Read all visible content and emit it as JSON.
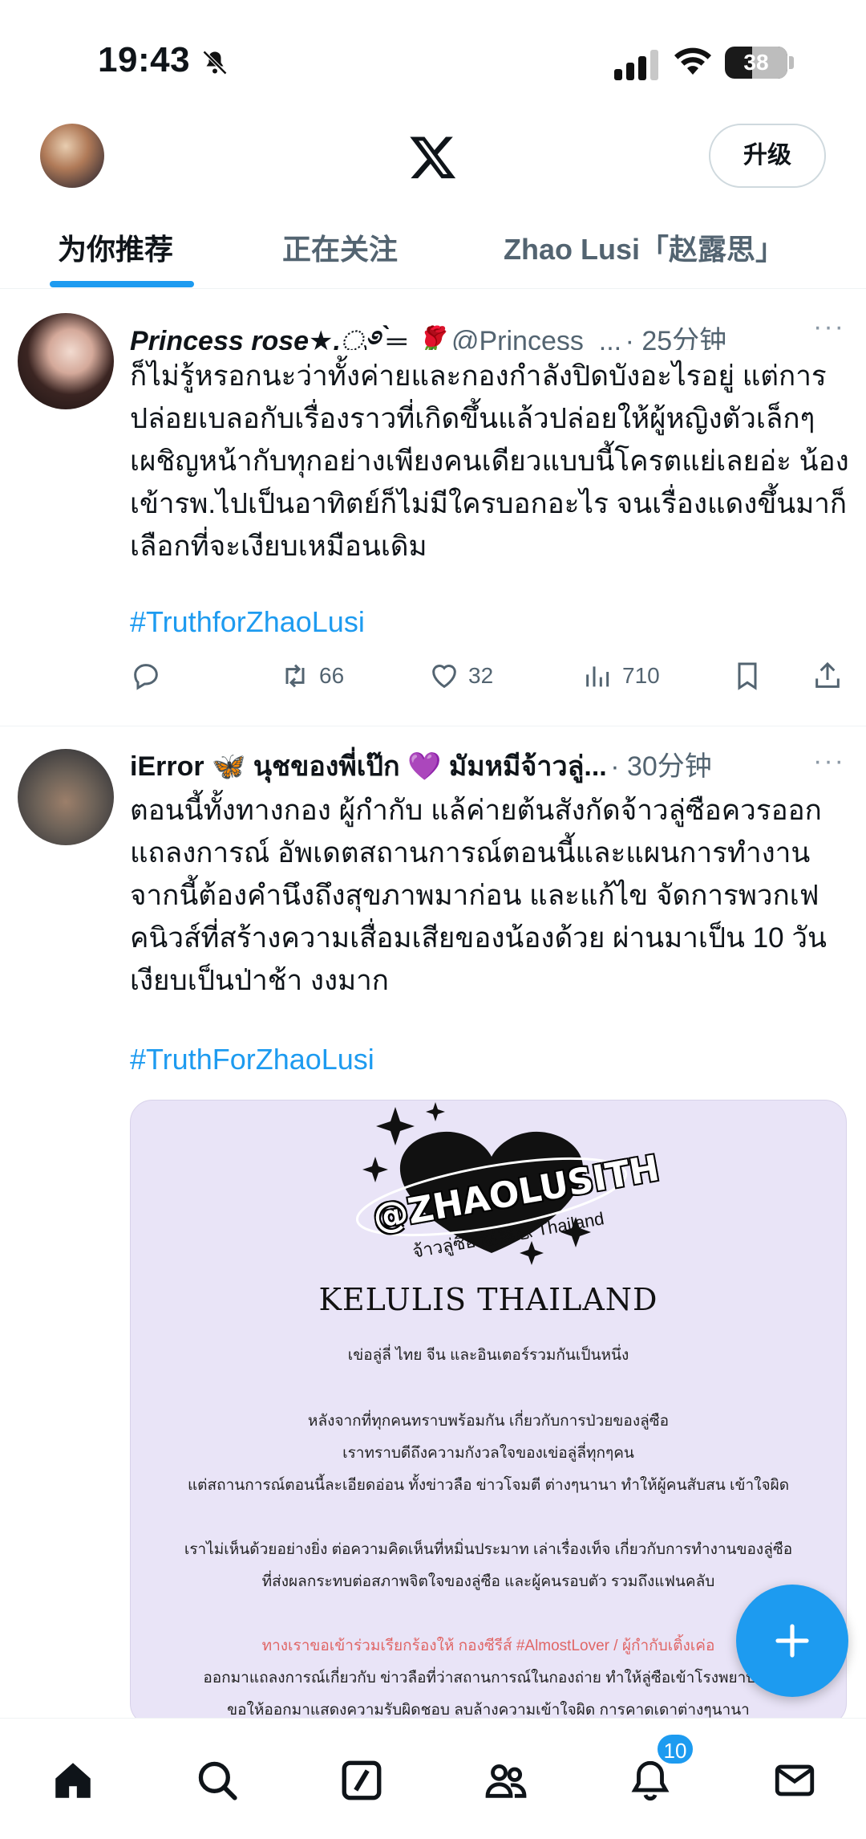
{
  "status_bar": {
    "time": "19:43",
    "battery": "38"
  },
  "header": {
    "upgrade_label": "升级"
  },
  "tabs": [
    {
      "label": "为你推荐"
    },
    {
      "label": "正在关注"
    },
    {
      "label": "Zhao Lusi「赵露思」"
    }
  ],
  "posts": [
    {
      "name": "Princess rose★.ೃ࿔ ̗̀═ 🌹",
      "handle": "@Princess_...",
      "time": "· 25分钟",
      "more": "···",
      "text": "ก็ไม่รู้หรอกนะว่าทั้งค่ายและกองกำลังปิดบังอะไรอยู่ แต่การปล่อยเบลอกับเรื่องราวที่เกิดขึ้นแล้วปล่อยให้ผู้หญิงตัวเล็กๆเผชิญหน้ากับทุกอย่างเพียงคนเดียวแบบนี้โครตแย่เลยอ่ะ น้องเข้ารพ.ไปเป็นอาทิตย์ก็ไม่มีใครบอกอะไร จนเรื่องแดงขึ้นมาก็เลือกที่จะเงียบเหมือนเดิม",
      "hashtag": "#TruthforZhaoLusi",
      "retweets": "66",
      "likes": "32",
      "views": "710"
    },
    {
      "name": "iError 🦋 นุชของพี่เป๊ก 💜 มัมหมีจ้าวลู่...",
      "time": "· 30分钟",
      "more": "···",
      "text": "ตอนนี้ทั้งทางกอง ผู้กำกับ แล้ค่ายต้นสังกัดจ้าวลู่ซือควรออกแถลงการณ์ อัพเดตสถานการณ์ตอนนี้และแผนการทำงานจากนี้ต้องคำนึงถึงสุขภาพมาก่อน และแก้ไข จัดการพวกเฟคนิวส์ที่สร้างความเสื่อมเสียของน้องด้วย ผ่านมาเป็น 10 วัน เงียบเป็นป่าช้า งงมาก",
      "hashtag": "#TruthForZhaoLusi",
      "media": {
        "logo_text": "@ZHAOLUSITH",
        "logo_sub": "จ้าวลู่ซือ 赵露思 Thailand",
        "title": "KELULIS THAILAND",
        "lines": [
          "เข่อลู่ลี่ ไทย จีน และอินเตอร์รวมกันเป็นหนึ่ง",
          "หลังจากที่ทุกคนทราบพร้อมกัน เกี่ยวกับการป่วยของลู่ซือ",
          "เราทราบดีถึงความกังวลใจของเข่อลู่ลี่ทุกๆคน",
          "แต่สถานการณ์ตอนนี้ละเอียดอ่อน ทั้งข่าวลือ ข่าวโจมตี ต่างๆนานา ทำให้ผู้คนสับสน เข้าใจผิด",
          "เราไม่เห็นด้วยอย่างยิ่ง ต่อความคิดเห็นที่หมิ่นประมาท เล่าเรื่องเท็จ เกี่ยวกับการทำงานของลู่ซือ",
          "ที่ส่งผลกระทบต่อสภาพจิตใจของลู่ซือ และผู้คนรอบตัว รวมถึงแฟนคลับ",
          "ทางเราขอเข้าร่วมเรียกร้องให้ กองซีรีส์ #AlmostLover / ผู้กำกับเติ้งเค่อ",
          "ออกมาแถลงการณ์เกี่ยวกับ ข่าวลือที่ว่าสถานการณ์ในกองถ่าย ทำให้ลู่ซือเข้าโรงพยาบาล",
          "ขอให้ออกมาแสดงความรับผิดชอบ ลบล้างความเข้าใจผิด การคาดเดาต่างๆนานา"
        ]
      }
    }
  ],
  "nav": {
    "notifications_badge": "10"
  },
  "colors": {
    "accent": "#1d9bf0",
    "text": "#0f1419",
    "muted": "#536471"
  }
}
